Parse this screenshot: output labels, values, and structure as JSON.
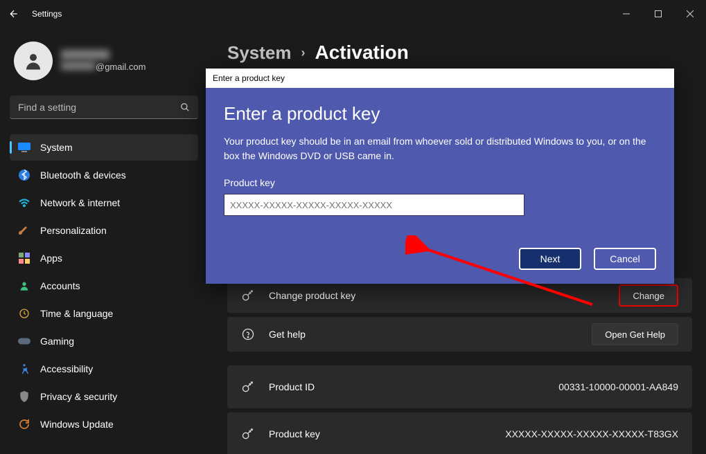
{
  "titlebar": {
    "back_icon": "back",
    "title": "Settings"
  },
  "user": {
    "name": "████",
    "email": "@gmail.com"
  },
  "search": {
    "placeholder": "Find a setting"
  },
  "nav": {
    "items": [
      {
        "label": "System",
        "icon": "system",
        "active": true
      },
      {
        "label": "Bluetooth & devices",
        "icon": "bluetooth"
      },
      {
        "label": "Network & internet",
        "icon": "wifi"
      },
      {
        "label": "Personalization",
        "icon": "brush"
      },
      {
        "label": "Apps",
        "icon": "apps"
      },
      {
        "label": "Accounts",
        "icon": "person"
      },
      {
        "label": "Time & language",
        "icon": "clock"
      },
      {
        "label": "Gaming",
        "icon": "gamepad"
      },
      {
        "label": "Accessibility",
        "icon": "access"
      },
      {
        "label": "Privacy & security",
        "icon": "shield"
      },
      {
        "label": "Windows Update",
        "icon": "update"
      }
    ]
  },
  "breadcrumb": {
    "parent": "System",
    "sep": "›",
    "current": "Activation"
  },
  "settings": {
    "change_key": {
      "label": "Change product key",
      "button": "Change"
    },
    "get_help": {
      "label": "Get help",
      "button": "Open Get Help"
    },
    "product_id": {
      "label": "Product ID",
      "value": "00331-10000-00001-AA849"
    },
    "product_key": {
      "label": "Product key",
      "value": "XXXXX-XXXXX-XXXXX-XXXXX-T83GX"
    }
  },
  "modal": {
    "window_title": "Enter a product key",
    "title": "Enter a product key",
    "description": "Your product key should be in an email from whoever sold or distributed Windows to you, or on the box the Windows DVD or USB came in.",
    "field_label": "Product key",
    "placeholder": "XXXXX-XXXXX-XXXXX-XXXXX-XXXXX",
    "next": "Next",
    "cancel": "Cancel"
  }
}
